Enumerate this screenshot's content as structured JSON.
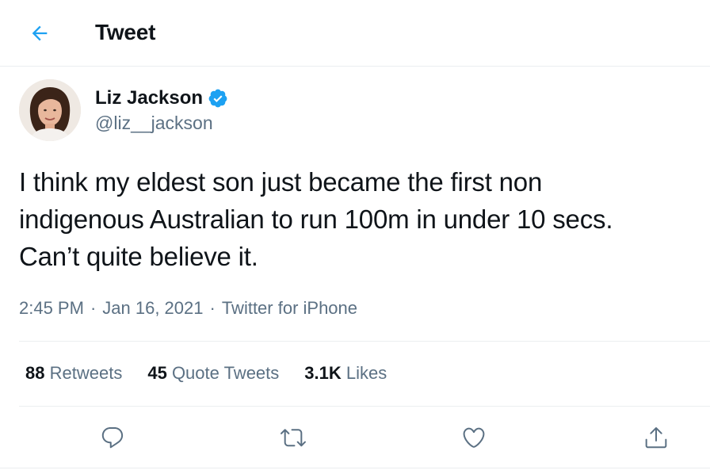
{
  "header": {
    "title": "Tweet",
    "back_icon": "arrow-left-icon",
    "accent_color": "#1da1f2"
  },
  "author": {
    "name": "Liz Jackson",
    "handle": "@liz__jackson",
    "verified": true,
    "verified_icon": "verified-badge-icon"
  },
  "tweet": {
    "text": "I think my eldest son just became the first non\nindigenous Australian to run 100m in under 10 secs.\nCan’t quite believe it.",
    "time": "2:45 PM",
    "separator": "·",
    "date": "Jan 16, 2021",
    "source": "Twitter for iPhone"
  },
  "stats": {
    "retweets_count": "88",
    "retweets_label": "Retweets",
    "quotes_count": "45",
    "quotes_label": "Quote Tweets",
    "likes_count": "3.1K",
    "likes_label": "Likes"
  },
  "actions": [
    {
      "name": "reply",
      "icon": "reply-icon"
    },
    {
      "name": "retweet",
      "icon": "retweet-icon"
    },
    {
      "name": "like",
      "icon": "heart-icon"
    },
    {
      "name": "share",
      "icon": "share-icon"
    }
  ],
  "colors": {
    "text_primary": "#0f1419",
    "text_secondary": "#5b7083",
    "border": "#ebeef0",
    "action_icon": "#5b7083"
  }
}
